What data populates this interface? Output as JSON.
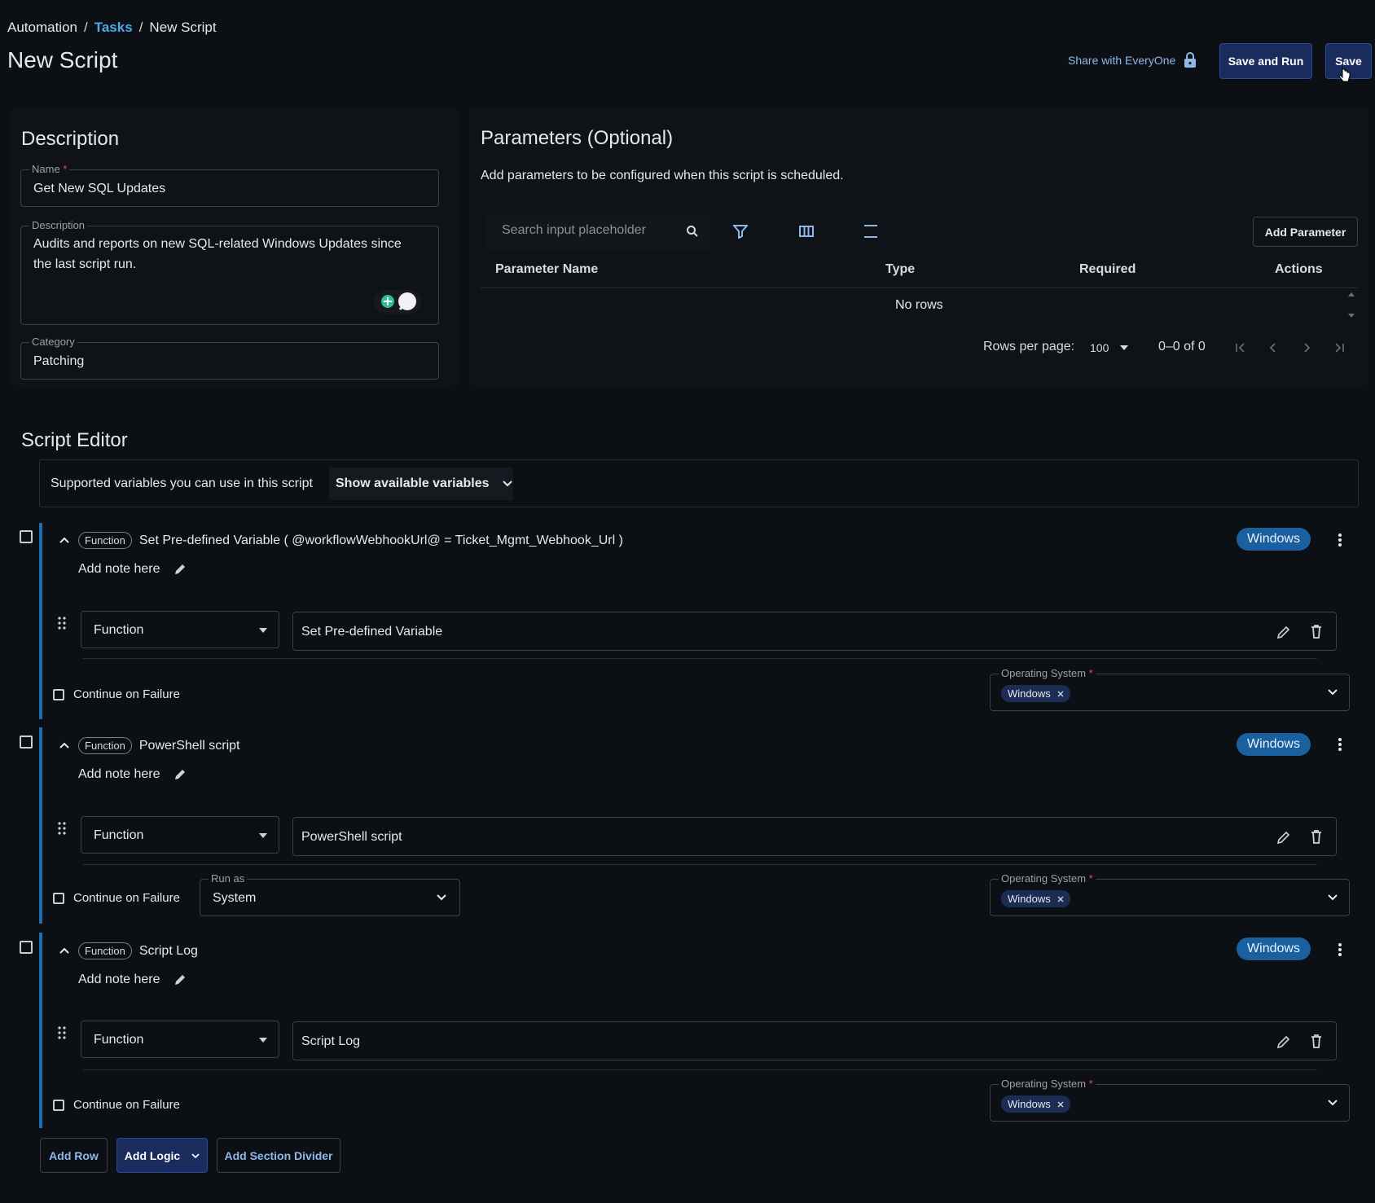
{
  "breadcrumb": {
    "root": "Automation",
    "sep1": "/",
    "tasks": "Tasks",
    "sep2": "/",
    "current": "New Script"
  },
  "page_title": "New Script",
  "header": {
    "share_label": "Share with EveryOne",
    "save_and_run": "Save and Run",
    "save": "Save"
  },
  "description_panel": {
    "title": "Description",
    "name_label": "Name",
    "required_mark": "*",
    "name_value": "Get New SQL Updates",
    "description_label": "Description",
    "description_line1": "Audits and reports on new SQL-related Windows Updates since",
    "description_line2": "the last script run.",
    "category_label": "Category",
    "category_value": "Patching"
  },
  "parameters_panel": {
    "title": "Parameters (Optional)",
    "subtitle": "Add parameters to be configured when this script is scheduled.",
    "search_placeholder": "Search input placeholder",
    "add_parameter": "Add Parameter",
    "columns": [
      "Parameter Name",
      "Type",
      "Required",
      "Actions"
    ],
    "empty_text": "No rows",
    "rows_per_page_label": "Rows per page:",
    "rows_per_page_value": "100",
    "range_text": "0–0 of 0"
  },
  "script_editor": {
    "title": "Script Editor",
    "vars_text": "Supported variables you can use in this script",
    "vars_button": "Show available variables",
    "rows": [
      {
        "chip": "Function",
        "title": "Set Pre-defined Variable ( @workflowWebhookUrl@ = Ticket_Mgmt_Webhook_Url )",
        "os_badge": "Windows",
        "note": "Add note here",
        "type_value": "Function",
        "function_value": "Set Pre-defined Variable",
        "continue_label": "Continue on Failure",
        "os_label": "Operating System",
        "os_chip": "Windows"
      },
      {
        "chip": "Function",
        "title": "PowerShell script",
        "os_badge": "Windows",
        "note": "Add note here",
        "type_value": "Function",
        "function_value": "PowerShell script",
        "continue_label": "Continue on Failure",
        "run_as_label": "Run as",
        "run_as_value": "System",
        "os_label": "Operating System",
        "os_chip": "Windows"
      },
      {
        "chip": "Function",
        "title": "Script Log",
        "os_badge": "Windows",
        "note": "Add note here",
        "type_value": "Function",
        "function_value": "Script Log",
        "continue_label": "Continue on Failure",
        "os_label": "Operating System",
        "os_chip": "Windows"
      }
    ],
    "add_row": "Add Row",
    "add_logic": "Add Logic",
    "add_section_divider": "Add Section Divider"
  },
  "colors": {
    "accent": "#1f6bb0",
    "link": "#4fa9e8",
    "badge": "#1a5f9e",
    "primary_button": "#1a2c5e"
  }
}
